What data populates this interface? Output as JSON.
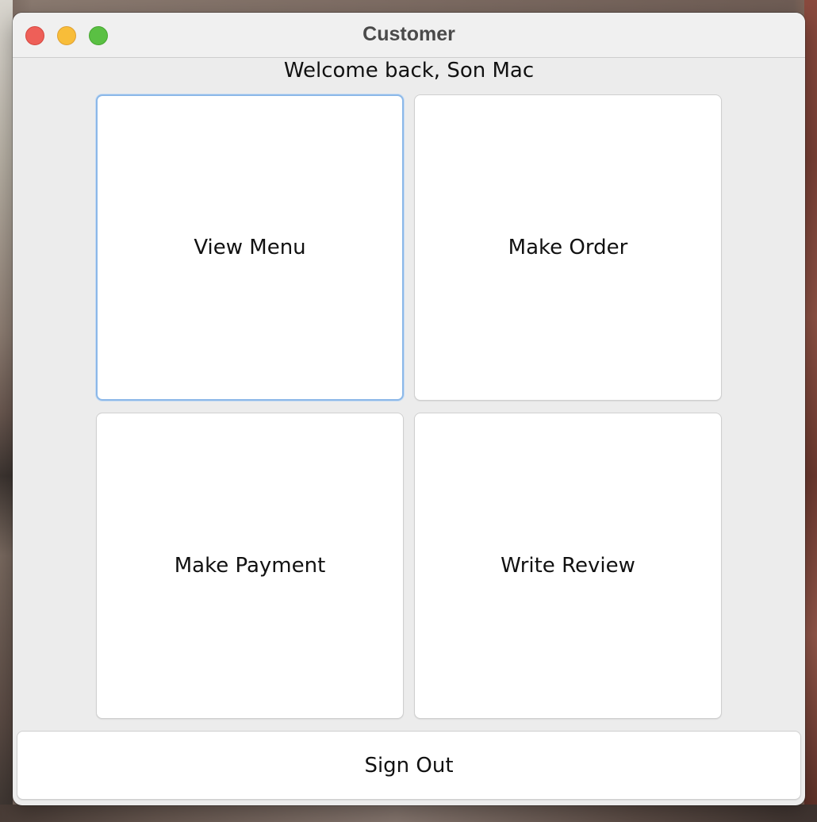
{
  "window": {
    "title": "Customer",
    "controls": {
      "close": "close-button",
      "minimize": "minimize-button",
      "zoom": "zoom-button"
    }
  },
  "welcome_text": "Welcome back, Son Mac",
  "actions": [
    {
      "label": "View Menu"
    },
    {
      "label": "Make Order"
    },
    {
      "label": "Make Payment"
    },
    {
      "label": "Write Review"
    }
  ],
  "sign_out_label": "Sign Out",
  "colors": {
    "window_bg": "#ececec",
    "titlebar_bg": "#f0f0f0",
    "tile_bg": "#ffffff",
    "focus_ring": "#8cb8e8",
    "close": "#ee5f58",
    "minimize": "#f8bd39",
    "zoom": "#5ac043"
  }
}
